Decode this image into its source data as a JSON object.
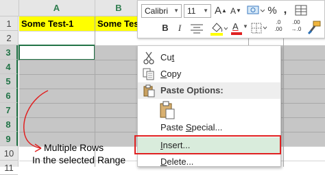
{
  "columns": [
    "A",
    "B"
  ],
  "rows": [
    "1",
    "2",
    "3",
    "4",
    "5",
    "6",
    "7",
    "8",
    "9",
    "10",
    "11"
  ],
  "cells": {
    "a1": "Some Test-1",
    "b1": "Some Test"
  },
  "mini_toolbar": {
    "font_name": "Calibri",
    "font_size": "11",
    "grow_label": "A",
    "shrink_label": "A",
    "percent_label": "%",
    "comma_label": ",",
    "bold_label": "B",
    "italic_label": "I",
    "font_color_label": "A",
    "dec_increase_top": ".0",
    "dec_increase_bottom": ".00",
    "dec_decrease_top": ".00",
    "dec_decrease_bottom": "→.0"
  },
  "context_menu": {
    "cut": {
      "pre": "Cu",
      "key": "t",
      "post": ""
    },
    "copy": {
      "pre": "",
      "key": "C",
      "post": "opy"
    },
    "paste_options": "Paste Options:",
    "paste_special": {
      "pre": "Paste ",
      "key": "S",
      "post": "pecial..."
    },
    "insert": {
      "pre": "",
      "key": "I",
      "post": "nsert..."
    },
    "delete": {
      "pre": "",
      "key": "D",
      "post": "elete..."
    }
  },
  "annotation": {
    "line1": "Multiple Rows",
    "line2": "In the selected Range"
  },
  "colors": {
    "selection_green": "#217346",
    "highlight_yellow": "#ffff00",
    "selected_gray": "#c6c6c6",
    "annotation_red": "#e02020",
    "insert_highlight": "#d9ecdc",
    "font_color_bar": "#e02020"
  }
}
